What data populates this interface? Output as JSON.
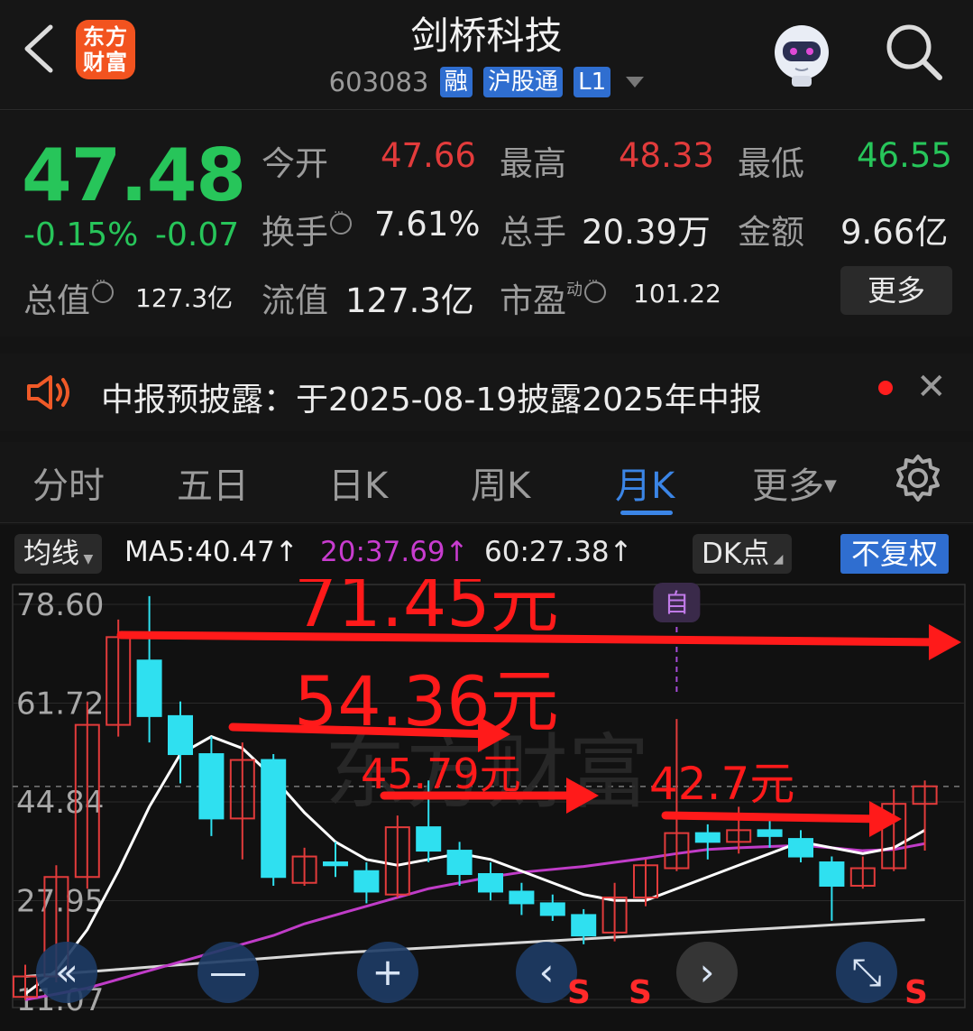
{
  "header": {
    "logo_text": "东方\n财富",
    "title": "剑桥科技",
    "code": "603083",
    "tags": [
      "融",
      "沪股通",
      "L1"
    ]
  },
  "quote": {
    "price": "47.48",
    "change_pct": "-0.15%",
    "change_amt": "-0.07",
    "open_label": "今开",
    "open": "47.66",
    "high_label": "最高",
    "high": "48.33",
    "low_label": "最低",
    "low": "46.55",
    "turnover_label": "换手",
    "turnover": "7.61%",
    "volume_label": "总手",
    "volume": "20.39万",
    "amount_label": "金额",
    "amount": "9.66亿",
    "mktcap_label": "总值",
    "mktcap": "127.3亿",
    "float_label": "流值",
    "float": "127.3亿",
    "pe_label": "市盈",
    "pe_sup": "动",
    "pe": "101.22",
    "more": "更多"
  },
  "notice": {
    "text": "中报预披露：于2025-08-19披露2025年中报"
  },
  "tabs": [
    "分时",
    "五日",
    "日K",
    "周K",
    "月K",
    "更多"
  ],
  "chart_toolbar": {
    "ma_selector": "均线",
    "ma5": "MA5:40.47↑",
    "ma20": "20:37.69↑",
    "ma60": "60:27.38↑",
    "dk": "DK点",
    "fq": "不复权"
  },
  "colors": {
    "up": "#e23b3b",
    "down": "#2fe0f0",
    "ma5": "#ffffff",
    "ma20": "#c03cc8",
    "ma60": "#d8d8d8",
    "accent": "#3b85e6"
  },
  "chart_data": {
    "type": "candlestick",
    "y_ticks": [
      "78.60",
      "61.72",
      "44.84",
      "27.95",
      "11.07"
    ],
    "ylim": [
      11.07,
      78.6
    ],
    "marker_label": "自",
    "signals": [
      "S",
      "S",
      "S"
    ],
    "annotations": [
      "71.45元",
      "54.36元",
      "45.79元",
      "42.7元"
    ],
    "candles": [
      {
        "o": 11.5,
        "c": 15.0,
        "h": 17.0,
        "l": 11.0
      },
      {
        "o": 15.0,
        "c": 32.0,
        "h": 34.0,
        "l": 14.0
      },
      {
        "o": 32.0,
        "c": 58.0,
        "h": 62.0,
        "l": 30.0
      },
      {
        "o": 58.0,
        "c": 73.0,
        "h": 76.0,
        "l": 56.0
      },
      {
        "o": 69.0,
        "c": 59.5,
        "h": 80.0,
        "l": 55.0
      },
      {
        "o": 59.5,
        "c": 53.0,
        "h": 62.0,
        "l": 48.0
      },
      {
        "o": 53.0,
        "c": 42.0,
        "h": 56.0,
        "l": 39.0
      },
      {
        "o": 42.0,
        "c": 52.0,
        "h": 55.0,
        "l": 35.0
      },
      {
        "o": 52.0,
        "c": 32.0,
        "h": 53.0,
        "l": 30.5
      },
      {
        "o": 31.0,
        "c": 35.5,
        "h": 37.0,
        "l": 30.5
      },
      {
        "o": 34.5,
        "c": 34.0,
        "h": 38.0,
        "l": 32.0
      },
      {
        "o": 33.0,
        "c": 29.5,
        "h": 34.5,
        "l": 27.5
      },
      {
        "o": 29.0,
        "c": 40.5,
        "h": 42.5,
        "l": 28.5
      },
      {
        "o": 40.5,
        "c": 36.5,
        "h": 48.5,
        "l": 34.5
      },
      {
        "o": 36.5,
        "c": 32.5,
        "h": 38.0,
        "l": 30.5
      },
      {
        "o": 32.5,
        "c": 29.5,
        "h": 34.5,
        "l": 28.0
      },
      {
        "o": 29.5,
        "c": 27.5,
        "h": 31.0,
        "l": 25.5
      },
      {
        "o": 27.5,
        "c": 25.5,
        "h": 29.0,
        "l": 24.5
      },
      {
        "o": 25.5,
        "c": 22.0,
        "h": 26.5,
        "l": 20.5
      },
      {
        "o": 22.5,
        "c": 28.5,
        "h": 31.0,
        "l": 21.0
      },
      {
        "o": 28.5,
        "c": 34.0,
        "h": 35.0,
        "l": 27.0
      },
      {
        "o": 33.5,
        "c": 39.5,
        "h": 59.0,
        "l": 33.0
      },
      {
        "o": 39.5,
        "c": 38.0,
        "h": 41.0,
        "l": 35.0
      },
      {
        "o": 38.0,
        "c": 40.0,
        "h": 44.0,
        "l": 36.0
      },
      {
        "o": 40.0,
        "c": 39.0,
        "h": 42.5,
        "l": 37.0
      },
      {
        "o": 38.5,
        "c": 35.5,
        "h": 40.0,
        "l": 34.5
      },
      {
        "o": 34.5,
        "c": 30.5,
        "h": 35.5,
        "l": 24.5
      },
      {
        "o": 30.5,
        "c": 33.5,
        "h": 35.5,
        "l": 30.0
      },
      {
        "o": 33.5,
        "c": 44.5,
        "h": 47.0,
        "l": 33.0
      },
      {
        "o": 44.5,
        "c": 47.5,
        "h": 48.5,
        "l": 36.5
      }
    ],
    "ma5": [
      12,
      16,
      23,
      33,
      44,
      53,
      56,
      54,
      49,
      43,
      38,
      35,
      34,
      35,
      36,
      35,
      33,
      31,
      29,
      28,
      28,
      30,
      32,
      34,
      36,
      38,
      37,
      36,
      37,
      40
    ],
    "ma20": [
      11,
      12,
      13,
      14.5,
      16,
      17.5,
      19,
      20.5,
      22,
      24,
      25.5,
      27,
      28.5,
      30,
      31,
      32,
      32.8,
      33.3,
      33.8,
      34.5,
      35.2,
      36,
      36.7,
      37,
      37.2,
      37.4,
      37,
      36.5,
      36.7,
      37.7
    ],
    "ma60": [
      15,
      15.4,
      15.8,
      16.2,
      16.6,
      17,
      17.4,
      17.8,
      18.2,
      18.6,
      19,
      19.3,
      19.6,
      19.9,
      20.2,
      20.5,
      20.8,
      21.1,
      21.4,
      21.7,
      22,
      22.3,
      22.6,
      22.9,
      23.2,
      23.5,
      23.8,
      24.1,
      24.4,
      24.7
    ]
  }
}
